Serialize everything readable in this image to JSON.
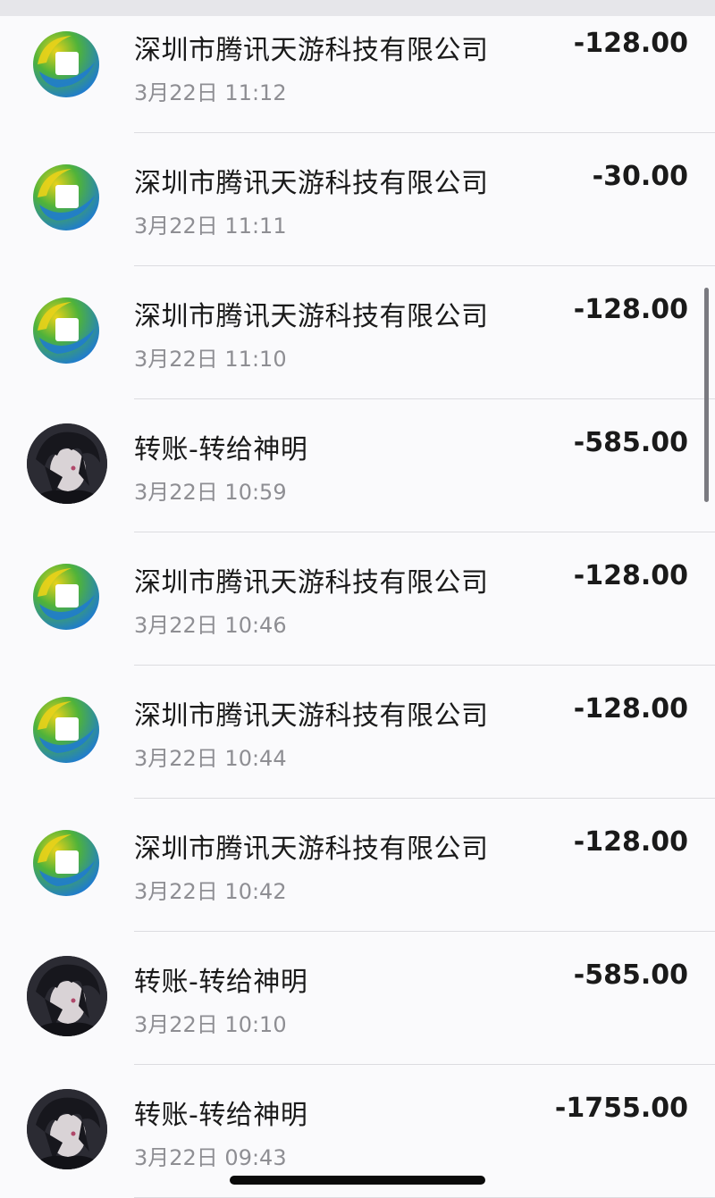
{
  "transactions": [
    {
      "type": "merchant",
      "name": "深圳市腾讯天游科技有限公司",
      "time": "3月22日 11:12",
      "amount": "-128.00"
    },
    {
      "type": "merchant",
      "name": "深圳市腾讯天游科技有限公司",
      "time": "3月22日 11:11",
      "amount": "-30.00"
    },
    {
      "type": "merchant",
      "name": "深圳市腾讯天游科技有限公司",
      "time": "3月22日 11:10",
      "amount": "-128.00"
    },
    {
      "type": "person",
      "name": "转账-转给神明",
      "time": "3月22日 10:59",
      "amount": "-585.00"
    },
    {
      "type": "merchant",
      "name": "深圳市腾讯天游科技有限公司",
      "time": "3月22日 10:46",
      "amount": "-128.00"
    },
    {
      "type": "merchant",
      "name": "深圳市腾讯天游科技有限公司",
      "time": "3月22日 10:44",
      "amount": "-128.00"
    },
    {
      "type": "merchant",
      "name": "深圳市腾讯天游科技有限公司",
      "time": "3月22日 10:42",
      "amount": "-128.00"
    },
    {
      "type": "person",
      "name": "转账-转给神明",
      "time": "3月22日 10:10",
      "amount": "-585.00"
    },
    {
      "type": "person",
      "name": "转账-转给神明",
      "time": "3月22日 09:43",
      "amount": "-1755.00"
    }
  ],
  "icons": {
    "merchant": "bank-logo-icon",
    "person": "user-avatar"
  },
  "colors": {
    "text_primary": "#1a1a1a",
    "text_secondary": "#8e8e93",
    "logo_yellow": "#e9d21a",
    "logo_green": "#4fb33a",
    "logo_blue": "#1e7ad1"
  }
}
